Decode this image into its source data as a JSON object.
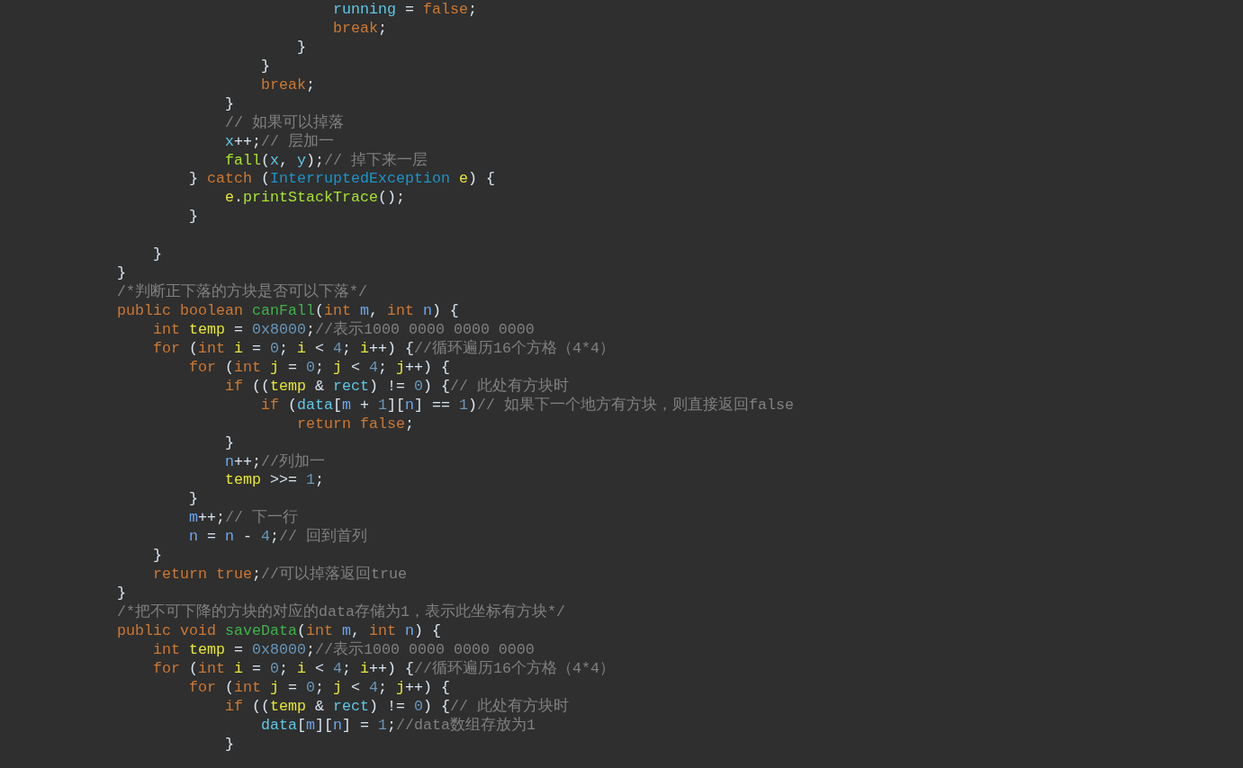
{
  "editor": {
    "lines": [
      {
        "kind": "block",
        "children": [
          {
            "kind": "block",
            "children": [
              {
                "kind": "block",
                "children": [
                  {
                    "kind": "block",
                    "children": [
                      {
                        "kind": "block",
                        "children": [
                          {
                            "kind": "block",
                            "children": [
                              {
                                "kind": "code",
                                "tokens": [
                                  {
                                    "kind": "field",
                                    "text": "running"
                                  },
                                  {
                                    "kind": "plain",
                                    "text": " = "
                                  },
                                  {
                                    "kind": "keyword",
                                    "text": "false"
                                  },
                                  {
                                    "kind": "plain",
                                    "text": ";"
                                  }
                                ]
                              },
                              {
                                "kind": "code",
                                "tokens": [
                                  {
                                    "kind": "keyword",
                                    "text": "break"
                                  },
                                  {
                                    "kind": "plain",
                                    "text": ";"
                                  }
                                ]
                              }
                            ]
                          },
                          {
                            "kind": "code",
                            "tokens": [
                              {
                                "kind": "plain",
                                "text": "}"
                              }
                            ]
                          }
                        ]
                      },
                      {
                        "kind": "code",
                        "tokens": [
                          {
                            "kind": "plain",
                            "text": "}"
                          }
                        ]
                      },
                      {
                        "kind": "code",
                        "tokens": [
                          {
                            "kind": "keyword",
                            "text": "break"
                          },
                          {
                            "kind": "plain",
                            "text": ";"
                          }
                        ]
                      }
                    ]
                  },
                  {
                    "kind": "code",
                    "tokens": [
                      {
                        "kind": "plain",
                        "text": "}"
                      }
                    ]
                  },
                  {
                    "kind": "code",
                    "tokens": [
                      {
                        "kind": "comment",
                        "text": "// 如果可以掉落"
                      }
                    ]
                  },
                  {
                    "kind": "code",
                    "tokens": [
                      {
                        "kind": "field",
                        "text": "x"
                      },
                      {
                        "kind": "plain",
                        "text": "++;"
                      },
                      {
                        "kind": "comment",
                        "text": "// 层加一"
                      }
                    ]
                  },
                  {
                    "kind": "code",
                    "tokens": [
                      {
                        "kind": "call",
                        "text": "fall"
                      },
                      {
                        "kind": "plain",
                        "text": "("
                      },
                      {
                        "kind": "field",
                        "text": "x"
                      },
                      {
                        "kind": "plain",
                        "text": ", "
                      },
                      {
                        "kind": "field",
                        "text": "y"
                      },
                      {
                        "kind": "plain",
                        "text": ");"
                      },
                      {
                        "kind": "comment",
                        "text": "// 掉下来一层"
                      }
                    ]
                  }
                ]
              },
              {
                "kind": "code",
                "tokens": [
                  {
                    "kind": "plain",
                    "text": "} "
                  },
                  {
                    "kind": "keyword",
                    "text": "catch"
                  },
                  {
                    "kind": "plain",
                    "text": " ("
                  },
                  {
                    "kind": "type",
                    "text": "InterruptedException "
                  },
                  {
                    "kind": "local",
                    "text": "e"
                  },
                  {
                    "kind": "plain",
                    "text": ") {"
                  }
                ],
                "children": [
                  {
                    "kind": "code",
                    "tokens": [
                      {
                        "kind": "local",
                        "text": "e"
                      },
                      {
                        "kind": "plain",
                        "text": "."
                      },
                      {
                        "kind": "call",
                        "text": "printStackTrace"
                      },
                      {
                        "kind": "plain",
                        "text": "();"
                      }
                    ]
                  }
                ]
              },
              {
                "kind": "code",
                "tokens": [
                  {
                    "kind": "plain",
                    "text": "}"
                  }
                ]
              }
            ]
          },
          {
            "kind": "blank"
          },
          {
            "kind": "code",
            "tokens": [
              {
                "kind": "plain",
                "text": "}"
              }
            ]
          }
        ]
      },
      {
        "kind": "code",
        "tokens": [
          {
            "kind": "plain",
            "text": "}"
          }
        ]
      },
      {
        "kind": "code",
        "tokens": [
          {
            "kind": "comment",
            "text": "/*判断正下落的方块是否可以下落*/"
          }
        ]
      },
      {
        "kind": "code",
        "tokens": [
          {
            "kind": "keyword",
            "text": "public boolean "
          },
          {
            "kind": "method",
            "text": "canFall"
          },
          {
            "kind": "plain",
            "text": "("
          },
          {
            "kind": "keyword",
            "text": "int "
          },
          {
            "kind": "param",
            "text": "m"
          },
          {
            "kind": "plain",
            "text": ", "
          },
          {
            "kind": "keyword",
            "text": "int "
          },
          {
            "kind": "param",
            "text": "n"
          },
          {
            "kind": "plain",
            "text": ") {"
          }
        ],
        "children": [
          {
            "kind": "code",
            "tokens": [
              {
                "kind": "keyword",
                "text": "int "
              },
              {
                "kind": "local",
                "text": "temp"
              },
              {
                "kind": "plain",
                "text": " = "
              },
              {
                "kind": "number",
                "text": "0x8000"
              },
              {
                "kind": "plain",
                "text": ";"
              },
              {
                "kind": "comment",
                "text": "//表示1000 0000 0000 0000"
              }
            ]
          },
          {
            "kind": "code",
            "tokens": [
              {
                "kind": "keyword",
                "text": "for"
              },
              {
                "kind": "plain",
                "text": " ("
              },
              {
                "kind": "keyword",
                "text": "int "
              },
              {
                "kind": "local",
                "text": "i"
              },
              {
                "kind": "plain",
                "text": " = "
              },
              {
                "kind": "number",
                "text": "0"
              },
              {
                "kind": "plain",
                "text": "; "
              },
              {
                "kind": "local",
                "text": "i"
              },
              {
                "kind": "plain",
                "text": " < "
              },
              {
                "kind": "number",
                "text": "4"
              },
              {
                "kind": "plain",
                "text": "; "
              },
              {
                "kind": "local",
                "text": "i"
              },
              {
                "kind": "plain",
                "text": "++) {"
              },
              {
                "kind": "comment",
                "text": "//循环遍历16个方格（4*4）"
              }
            ],
            "children": [
              {
                "kind": "code",
                "tokens": [
                  {
                    "kind": "keyword",
                    "text": "for"
                  },
                  {
                    "kind": "plain",
                    "text": " ("
                  },
                  {
                    "kind": "keyword",
                    "text": "int "
                  },
                  {
                    "kind": "local",
                    "text": "j"
                  },
                  {
                    "kind": "plain",
                    "text": " = "
                  },
                  {
                    "kind": "number",
                    "text": "0"
                  },
                  {
                    "kind": "plain",
                    "text": "; "
                  },
                  {
                    "kind": "local",
                    "text": "j"
                  },
                  {
                    "kind": "plain",
                    "text": " < "
                  },
                  {
                    "kind": "number",
                    "text": "4"
                  },
                  {
                    "kind": "plain",
                    "text": "; "
                  },
                  {
                    "kind": "local",
                    "text": "j"
                  },
                  {
                    "kind": "plain",
                    "text": "++) {"
                  }
                ],
                "children": [
                  {
                    "kind": "code",
                    "tokens": [
                      {
                        "kind": "keyword",
                        "text": "if"
                      },
                      {
                        "kind": "plain",
                        "text": " (("
                      },
                      {
                        "kind": "local",
                        "text": "temp"
                      },
                      {
                        "kind": "plain",
                        "text": " & "
                      },
                      {
                        "kind": "field",
                        "text": "rect"
                      },
                      {
                        "kind": "plain",
                        "text": ") != "
                      },
                      {
                        "kind": "number",
                        "text": "0"
                      },
                      {
                        "kind": "plain",
                        "text": ") {"
                      },
                      {
                        "kind": "comment",
                        "text": "// 此处有方块时"
                      }
                    ],
                    "children": [
                      {
                        "kind": "code",
                        "tokens": [
                          {
                            "kind": "keyword",
                            "text": "if"
                          },
                          {
                            "kind": "plain",
                            "text": " ("
                          },
                          {
                            "kind": "field",
                            "text": "data"
                          },
                          {
                            "kind": "plain",
                            "text": "["
                          },
                          {
                            "kind": "param",
                            "text": "m"
                          },
                          {
                            "kind": "plain",
                            "text": " + "
                          },
                          {
                            "kind": "number",
                            "text": "1"
                          },
                          {
                            "kind": "plain",
                            "text": "]["
                          },
                          {
                            "kind": "param",
                            "text": "n"
                          },
                          {
                            "kind": "plain",
                            "text": "] == "
                          },
                          {
                            "kind": "number",
                            "text": "1"
                          },
                          {
                            "kind": "plain",
                            "text": ")"
                          },
                          {
                            "kind": "comment",
                            "text": "// 如果下一个地方有方块，则直接返回false"
                          }
                        ],
                        "children": [
                          {
                            "kind": "code",
                            "tokens": [
                              {
                                "kind": "keyword",
                                "text": "return false"
                              },
                              {
                                "kind": "plain",
                                "text": ";"
                              }
                            ]
                          }
                        ]
                      }
                    ]
                  },
                  {
                    "kind": "code",
                    "tokens": [
                      {
                        "kind": "plain",
                        "text": "}"
                      }
                    ]
                  },
                  {
                    "kind": "code",
                    "tokens": [
                      {
                        "kind": "param",
                        "text": "n"
                      },
                      {
                        "kind": "plain",
                        "text": "++;"
                      },
                      {
                        "kind": "comment",
                        "text": "//列加一"
                      }
                    ]
                  },
                  {
                    "kind": "code",
                    "tokens": [
                      {
                        "kind": "local",
                        "text": "temp"
                      },
                      {
                        "kind": "plain",
                        "text": " >>= "
                      },
                      {
                        "kind": "number",
                        "text": "1"
                      },
                      {
                        "kind": "plain",
                        "text": ";"
                      }
                    ]
                  }
                ]
              },
              {
                "kind": "code",
                "tokens": [
                  {
                    "kind": "plain",
                    "text": "}"
                  }
                ]
              },
              {
                "kind": "code",
                "tokens": [
                  {
                    "kind": "param",
                    "text": "m"
                  },
                  {
                    "kind": "plain",
                    "text": "++;"
                  },
                  {
                    "kind": "comment",
                    "text": "// 下一行"
                  }
                ]
              },
              {
                "kind": "code",
                "tokens": [
                  {
                    "kind": "param",
                    "text": "n"
                  },
                  {
                    "kind": "plain",
                    "text": " = "
                  },
                  {
                    "kind": "param",
                    "text": "n"
                  },
                  {
                    "kind": "plain",
                    "text": " - "
                  },
                  {
                    "kind": "number",
                    "text": "4"
                  },
                  {
                    "kind": "plain",
                    "text": ";"
                  },
                  {
                    "kind": "comment",
                    "text": "// 回到首列"
                  }
                ]
              }
            ]
          },
          {
            "kind": "code",
            "tokens": [
              {
                "kind": "plain",
                "text": "}"
              }
            ]
          },
          {
            "kind": "code",
            "tokens": [
              {
                "kind": "keyword",
                "text": "return true"
              },
              {
                "kind": "plain",
                "text": ";"
              },
              {
                "kind": "comment",
                "text": "//可以掉落返回true"
              }
            ]
          }
        ]
      },
      {
        "kind": "code",
        "tokens": [
          {
            "kind": "plain",
            "text": "}"
          }
        ]
      },
      {
        "kind": "code",
        "tokens": [
          {
            "kind": "comment",
            "text": "/*把不可下降的方块的对应的data存储为1，表示此坐标有方块*/"
          }
        ]
      },
      {
        "kind": "code",
        "tokens": [
          {
            "kind": "keyword",
            "text": "public void "
          },
          {
            "kind": "method",
            "text": "saveData"
          },
          {
            "kind": "plain",
            "text": "("
          },
          {
            "kind": "keyword",
            "text": "int "
          },
          {
            "kind": "param",
            "text": "m"
          },
          {
            "kind": "plain",
            "text": ", "
          },
          {
            "kind": "keyword",
            "text": "int "
          },
          {
            "kind": "param",
            "text": "n"
          },
          {
            "kind": "plain",
            "text": ") {"
          }
        ],
        "children": [
          {
            "kind": "code",
            "tokens": [
              {
                "kind": "keyword",
                "text": "int "
              },
              {
                "kind": "local",
                "text": "temp"
              },
              {
                "kind": "plain",
                "text": " = "
              },
              {
                "kind": "number",
                "text": "0x8000"
              },
              {
                "kind": "plain",
                "text": ";"
              },
              {
                "kind": "comment",
                "text": "//表示1000 0000 0000 0000"
              }
            ]
          },
          {
            "kind": "code",
            "tokens": [
              {
                "kind": "keyword",
                "text": "for"
              },
              {
                "kind": "plain",
                "text": " ("
              },
              {
                "kind": "keyword",
                "text": "int "
              },
              {
                "kind": "local",
                "text": "i"
              },
              {
                "kind": "plain",
                "text": " = "
              },
              {
                "kind": "number",
                "text": "0"
              },
              {
                "kind": "plain",
                "text": "; "
              },
              {
                "kind": "local",
                "text": "i"
              },
              {
                "kind": "plain",
                "text": " < "
              },
              {
                "kind": "number",
                "text": "4"
              },
              {
                "kind": "plain",
                "text": "; "
              },
              {
                "kind": "local",
                "text": "i"
              },
              {
                "kind": "plain",
                "text": "++) {"
              },
              {
                "kind": "comment",
                "text": "//循环遍历16个方格（4*4）"
              }
            ],
            "children": [
              {
                "kind": "code",
                "tokens": [
                  {
                    "kind": "keyword",
                    "text": "for"
                  },
                  {
                    "kind": "plain",
                    "text": " ("
                  },
                  {
                    "kind": "keyword",
                    "text": "int "
                  },
                  {
                    "kind": "local",
                    "text": "j"
                  },
                  {
                    "kind": "plain",
                    "text": " = "
                  },
                  {
                    "kind": "number",
                    "text": "0"
                  },
                  {
                    "kind": "plain",
                    "text": "; "
                  },
                  {
                    "kind": "local",
                    "text": "j"
                  },
                  {
                    "kind": "plain",
                    "text": " < "
                  },
                  {
                    "kind": "number",
                    "text": "4"
                  },
                  {
                    "kind": "plain",
                    "text": "; "
                  },
                  {
                    "kind": "local",
                    "text": "j"
                  },
                  {
                    "kind": "plain",
                    "text": "++) {"
                  }
                ],
                "children": [
                  {
                    "kind": "code",
                    "tokens": [
                      {
                        "kind": "keyword",
                        "text": "if"
                      },
                      {
                        "kind": "plain",
                        "text": " (("
                      },
                      {
                        "kind": "local",
                        "text": "temp"
                      },
                      {
                        "kind": "plain",
                        "text": " & "
                      },
                      {
                        "kind": "field",
                        "text": "rect"
                      },
                      {
                        "kind": "plain",
                        "text": ") != "
                      },
                      {
                        "kind": "number",
                        "text": "0"
                      },
                      {
                        "kind": "plain",
                        "text": ") {"
                      },
                      {
                        "kind": "comment",
                        "text": "// 此处有方块时"
                      }
                    ],
                    "children": [
                      {
                        "kind": "code",
                        "tokens": [
                          {
                            "kind": "field",
                            "text": "data"
                          },
                          {
                            "kind": "plain",
                            "text": "["
                          },
                          {
                            "kind": "param",
                            "text": "m"
                          },
                          {
                            "kind": "plain",
                            "text": "]["
                          },
                          {
                            "kind": "param",
                            "text": "n"
                          },
                          {
                            "kind": "plain",
                            "text": "] = "
                          },
                          {
                            "kind": "number",
                            "text": "1"
                          },
                          {
                            "kind": "plain",
                            "text": ";"
                          },
                          {
                            "kind": "comment",
                            "text": "//data数组存放为1"
                          }
                        ]
                      }
                    ]
                  },
                  {
                    "kind": "code",
                    "tokens": [
                      {
                        "kind": "plain",
                        "text": "}"
                      }
                    ]
                  }
                ]
              }
            ]
          }
        ]
      }
    ]
  }
}
